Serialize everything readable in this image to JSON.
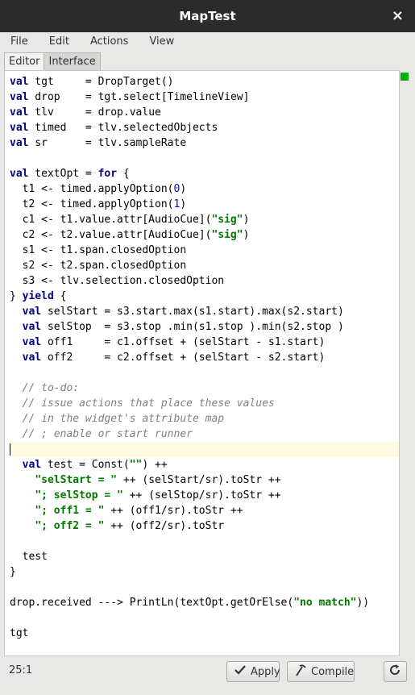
{
  "window": {
    "title": "MapTest",
    "close_label": "×"
  },
  "menu": [
    "File",
    "Edit",
    "Actions",
    "View"
  ],
  "tabs": [
    "Editor",
    "Interface"
  ],
  "code_lines": [
    [
      [
        "k",
        "val"
      ],
      [
        "t",
        " tgt     = DropTarget()"
      ]
    ],
    [
      [
        "k",
        "val"
      ],
      [
        "t",
        " drop    = tgt.select[TimelineView]"
      ]
    ],
    [
      [
        "k",
        "val"
      ],
      [
        "t",
        " tlv     = drop.value"
      ]
    ],
    [
      [
        "k",
        "val"
      ],
      [
        "t",
        " timed   = tlv.selectedObjects"
      ]
    ],
    [
      [
        "k",
        "val"
      ],
      [
        "t",
        " sr      = tlv.sampleRate"
      ]
    ],
    [],
    [
      [
        "k",
        "val"
      ],
      [
        "t",
        " textOpt = "
      ],
      [
        "k",
        "for"
      ],
      [
        "t",
        " {"
      ]
    ],
    [
      [
        "t",
        "  t1 <- timed.applyOption("
      ],
      [
        "n",
        "0"
      ],
      [
        "t",
        ")"
      ]
    ],
    [
      [
        "t",
        "  t2 <- timed.applyOption("
      ],
      [
        "n",
        "1"
      ],
      [
        "t",
        ")"
      ]
    ],
    [
      [
        "t",
        "  c1 <- t1.value.attr[AudioCue]("
      ],
      [
        "s",
        "\"sig\""
      ],
      [
        "t",
        ")"
      ]
    ],
    [
      [
        "t",
        "  c2 <- t2.value.attr[AudioCue]("
      ],
      [
        "s",
        "\"sig\""
      ],
      [
        "t",
        ")"
      ]
    ],
    [
      [
        "t",
        "  s1 <- t1.span.closedOption"
      ]
    ],
    [
      [
        "t",
        "  s2 <- t2.span.closedOption"
      ]
    ],
    [
      [
        "t",
        "  s3 <- tlv.selection.closedOption"
      ]
    ],
    [
      [
        "t",
        "} "
      ],
      [
        "k",
        "yield"
      ],
      [
        "t",
        " {"
      ]
    ],
    [
      [
        "t",
        "  "
      ],
      [
        "k",
        "val"
      ],
      [
        "t",
        " selStart = s3.start.max(s1.start).max(s2.start)"
      ]
    ],
    [
      [
        "t",
        "  "
      ],
      [
        "k",
        "val"
      ],
      [
        "t",
        " selStop  = s3.stop .min(s1.stop ).min(s2.stop )"
      ]
    ],
    [
      [
        "t",
        "  "
      ],
      [
        "k",
        "val"
      ],
      [
        "t",
        " off1     = c1.offset + (selStart - s1.start)"
      ]
    ],
    [
      [
        "t",
        "  "
      ],
      [
        "k",
        "val"
      ],
      [
        "t",
        " off2     = c2.offset + (selStart - s2.start)"
      ]
    ],
    [],
    [
      [
        "c",
        "  // to-do:"
      ]
    ],
    [
      [
        "c",
        "  // issue actions that place these values"
      ]
    ],
    [
      [
        "c",
        "  // in the widget's attribute map"
      ]
    ],
    [
      [
        "c",
        "  // ; enable or start runner"
      ]
    ],
    [],
    [
      [
        "t",
        "  "
      ],
      [
        "k",
        "val"
      ],
      [
        "t",
        " test = Const("
      ],
      [
        "s",
        "\"\""
      ],
      [
        "t",
        ") ++"
      ]
    ],
    [
      [
        "t",
        "    "
      ],
      [
        "s",
        "\"selStart = \""
      ],
      [
        "t",
        " ++ (selStart/sr).toStr ++"
      ]
    ],
    [
      [
        "t",
        "    "
      ],
      [
        "s",
        "\"; selStop = \""
      ],
      [
        "t",
        " ++ (selStop/sr).toStr ++"
      ]
    ],
    [
      [
        "t",
        "    "
      ],
      [
        "s",
        "\"; off1 = \""
      ],
      [
        "t",
        " ++ (off1/sr).toStr ++"
      ]
    ],
    [
      [
        "t",
        "    "
      ],
      [
        "s",
        "\"; off2 = \""
      ],
      [
        "t",
        " ++ (off2/sr).toStr"
      ]
    ],
    [],
    [
      [
        "t",
        "  test"
      ]
    ],
    [
      [
        "t",
        "}"
      ]
    ],
    [],
    [
      [
        "t",
        "drop.received ---> PrintLn(textOpt.getOrElse("
      ],
      [
        "s",
        "\"no match\""
      ],
      [
        "t",
        "))"
      ]
    ],
    [],
    [
      [
        "t",
        "tgt"
      ]
    ]
  ],
  "current_line_index": 24,
  "status": {
    "position": "25:1"
  },
  "buttons": {
    "apply": "Apply",
    "compile": "Compile"
  },
  "icons": {
    "apply": "check-icon",
    "compile": "compile-icon",
    "refresh": "refresh-icon"
  },
  "colors": {
    "keyword": "#000080",
    "string": "#007700",
    "number": "#0000ff",
    "comment": "#808080",
    "current_line": "#fefbe0",
    "status_ok": "#00b000"
  }
}
